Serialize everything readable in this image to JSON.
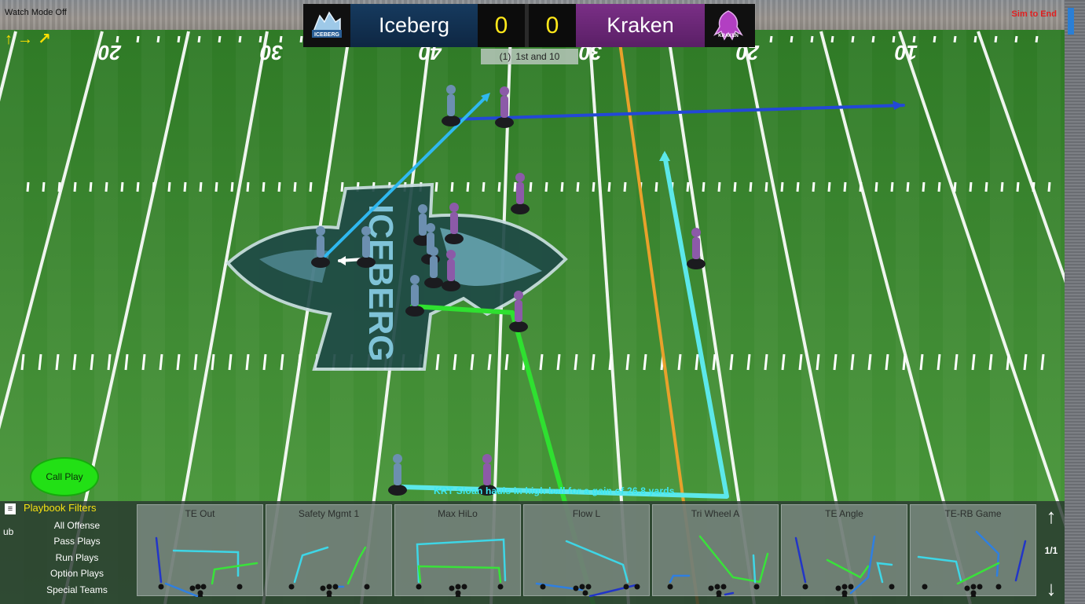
{
  "hud": {
    "watch_mode": "Watch Mode Off",
    "sim_to_end": "Sim to End",
    "direction_arrows": [
      "↑",
      "→",
      "↗"
    ]
  },
  "scoreboard": {
    "home_name": "Iceberg",
    "home_score": "0",
    "away_name": "Kraken",
    "away_score": "0",
    "home_logo_text": "ICEBERG",
    "away_logo_text": "KRAKEN",
    "home_color": "#163a5e",
    "away_color": "#7a2f86",
    "score_color": "#ffe81a"
  },
  "down": {
    "count": "(1)",
    "text": "1st and 10"
  },
  "field": {
    "yard_labels": [
      "20",
      "30",
      "40",
      "30",
      "20",
      "10"
    ],
    "midfield_logo_text": "ICEBERG",
    "grass_color": "#3f8a33"
  },
  "call_play": {
    "label": "Call Play",
    "color": "#22e015"
  },
  "play_result": "KRT Sloan hauls in high ball for a gain of 26.8 yards.",
  "playbook": {
    "menu_icon": "menu-icon",
    "filters_title": "Playbook Filters",
    "sub_label": "ub",
    "filters": [
      "All Offense",
      "Pass Plays",
      "Run Plays",
      "Option Plays",
      "Special Teams"
    ],
    "plays": [
      "TE Out",
      "Safety Mgmt 1",
      "Max HiLo",
      "Flow L",
      "Tri Wheel A",
      "TE Angle",
      "TE-RB Game"
    ],
    "page_up_icon": "arrow-up-icon",
    "page_down_icon": "arrow-down-icon",
    "page": "1/1"
  }
}
